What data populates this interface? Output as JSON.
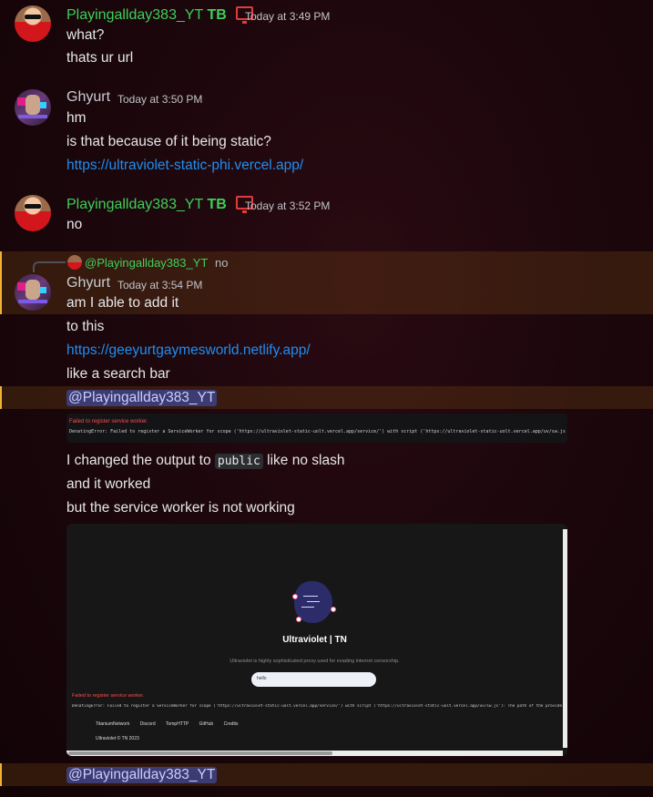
{
  "messages": [
    {
      "author": "Playingallday383_YT",
      "tag": "TB",
      "time": "Today at 3:49 PM",
      "lines": [
        "what?",
        "thats ur url"
      ]
    },
    {
      "author": "Ghyurt",
      "time": "Today at 3:50 PM",
      "lines": [
        "hm",
        "is that because of it being static?"
      ],
      "link": "https://ultraviolet-static-phi.vercel.app/"
    },
    {
      "author": "Playingallday383_YT",
      "tag": "TB",
      "time": "Today at 3:52 PM",
      "lines": [
        "no"
      ]
    },
    {
      "reply_to": "@Playingallday383_YT",
      "reply_text": "no",
      "author": "Ghyurt",
      "time": "Today at 3:54 PM",
      "lines": [
        "am I able to add it",
        "to this"
      ],
      "link": "https://geeyurtgaymesworld.netlify.app/",
      "after_link": "like a search bar",
      "mention": "@Playingallday383_YT",
      "error_embed": {
        "title": "Failed to register service worker.",
        "detail": "DenatingError: Failed to register a ServiceWorker for scope ('https://ultraviolet-static-uolt.vercel.app/service/') with script ('https://ultraviolet-static-uolt.vercel.app/uv/sw.js'): The path of the provided"
      },
      "para_pre": "I changed the output to ",
      "para_code": "public",
      "para_post": " like no slash",
      "line_worked": "and it worked",
      "line_sw": "but the service worker is not working",
      "screenshot": {
        "title": "Ultraviolet | TN",
        "subtitle": "Ultraviolet is highly sophisticated proxy used for evading internet censorship.",
        "input_value": "hello",
        "error_title": "Failed to register service worker.",
        "error_detail": "DenatingError: Failed to register a ServiceWorker for scope ('https://ultraviolet-static-uolt.vercel.app/service/') with script ('https://ultraviolet-static-uolt.vercel.app/uv/sw.js'): The path of the provided",
        "nav": [
          "TitaniumNetwork",
          "Discord",
          "TompHTTP",
          "GitHub",
          "Credits"
        ],
        "copyright": "Ultraviolet © TN 2023"
      }
    }
  ],
  "bottom_mention": "@Playingallday383_YT",
  "colors": {
    "username_green": "#3ecf5a",
    "link": "#1f8ef1",
    "mention_bg": "#3c3b73",
    "highlight_bar": "#f0b232"
  }
}
